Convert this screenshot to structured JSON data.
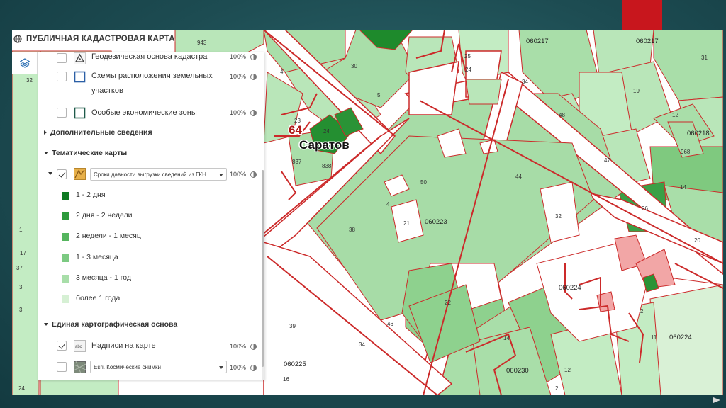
{
  "app": {
    "title": "ПУБЛИЧНАЯ КАДАСТРОВАЯ КАРТА"
  },
  "icons": {
    "header": "globe-icon",
    "layers_button": "layers-icon"
  },
  "panel": {
    "top_layers": [
      {
        "label": "Геодезическая основа кадастра",
        "opacity": "100%",
        "checked": false,
        "icon": "triangle-survey-icon"
      },
      {
        "label": "Схемы расположения земельных участков",
        "opacity": "100%",
        "checked": false,
        "icon": "square-outline-blue-icon"
      },
      {
        "label": "Особые экономические зоны",
        "opacity": "100%",
        "checked": false,
        "icon": "square-outline-green-icon"
      }
    ],
    "sections": {
      "additional": "Дополнительные сведения",
      "thematic": "Тематические карты",
      "base": "Единая картографическая основа"
    },
    "thematic_layer": {
      "checked": true,
      "select_value": "Сроки давности выгрузки сведений из ГКН",
      "opacity": "100%"
    },
    "legend": [
      {
        "label": "1 - 2 дня",
        "color": "#0e7a22"
      },
      {
        "label": "2 дня - 2 недели",
        "color": "#2d9a3c"
      },
      {
        "label": "2 недели - 1 месяц",
        "color": "#55b55e"
      },
      {
        "label": "1 - 3 месяца",
        "color": "#7cca82"
      },
      {
        "label": "3 месяца - 1 год",
        "color": "#a8dea9"
      },
      {
        "label": "более 1 года",
        "color": "#d6f0d4"
      }
    ],
    "base_layers": [
      {
        "label": "Надписи на карте",
        "opacity": "100%",
        "checked": true
      },
      {
        "label": "",
        "select_value": "Esri. Космические снимки",
        "opacity": "100%",
        "checked": false
      }
    ]
  },
  "map": {
    "city_label": "Саратов",
    "region_label": "64",
    "quarter_labels": [
      "060217",
      "060217",
      "060218",
      "060223",
      "060224",
      "060224",
      "060225",
      "060230"
    ],
    "parcel_numbers": [
      "943",
      "32",
      "30",
      "5",
      "24",
      "25",
      "34",
      "48",
      "19",
      "31",
      "4",
      "12",
      "23",
      "24",
      "838",
      "837",
      "968",
      "14",
      "26",
      "50",
      "44",
      "4",
      "21",
      "38",
      "32",
      "47",
      "22",
      "3",
      "37",
      "17",
      "39",
      "34",
      "46",
      "14",
      "12",
      "2",
      "11",
      "2",
      "24",
      "16",
      "3",
      "1",
      "20"
    ]
  },
  "colors": {
    "accent_red": "#c8161d",
    "map_boundary": "#cc2a2a",
    "panel_bg": "#ffffff",
    "slide_bg": "#1d4c52"
  }
}
